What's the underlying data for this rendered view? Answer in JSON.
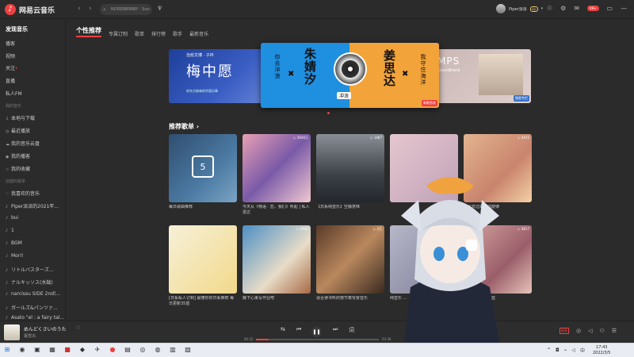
{
  "app": {
    "name": "网易云音乐"
  },
  "header": {
    "back": "‹",
    "forward": "›",
    "search_text": "NOISEBRINNY · Sun",
    "user_name": "Piper派派",
    "vip": "vip",
    "badge": "99+"
  },
  "sidebar": {
    "main": [
      "发现音乐",
      "播客",
      "视频",
      "关注",
      "直播",
      "私人FM"
    ],
    "my_music_head": "我的音乐",
    "my_music": [
      "本地与下载",
      "最近播放",
      "我的音乐云盘",
      "我的播客",
      "我的收藏"
    ],
    "created_head": "创建的歌单",
    "playlists": [
      "我喜欢的音乐",
      "Piper派派的2021年...",
      "bui",
      "1",
      "BGM",
      "Mori!",
      "リトルバスターズ...",
      "ナルキッソス(水鉞)",
      "narcissu SIDE 2nd(...",
      "ガールズ&パンツァ...",
      "Asato \"el : a fairy tal..."
    ]
  },
  "tabs": [
    "个性推荐",
    "专属订制",
    "歌单",
    "排行榜",
    "歌手",
    "最新音乐"
  ],
  "banners": {
    "left": {
      "top": "治愈文博 · 子衿",
      "title": "梅中愿",
      "bottom": "听东方韵味的华丽乐章"
    },
    "center": {
      "left_small": "你去冲浪",
      "left_big": "朱婧汐",
      "right_big": "姜思达",
      "right_small": "我守住海洋",
      "disc_label": "冲浪",
      "tag": "新歌首发"
    },
    "right": {
      "title": "MPS",
      "sub": "Soundtrack",
      "tag": "独家专栏"
    }
  },
  "section_title": "推荐歌单 ›",
  "cards": [
    {
      "title": "每日歌曲推荐",
      "count": "",
      "day": "5"
    },
    {
      "title": "今天从《物语 · 恋，我们》听起 | 私人雷达",
      "count": "▷ 5936万"
    },
    {
      "title": "【日系纯音乐】空静意味",
      "count": "▷ 1487"
    },
    {
      "title": "",
      "count": ""
    },
    {
      "title": "你喜欢过的心动旋律",
      "count": "▷ 4472"
    },
    {
      "title": "[日系私人订制] 最懂你的日系推荐 每日更新35首",
      "count": ""
    },
    {
      "title": "静下心来写作业吧",
      "count": "▷ 5932"
    },
    {
      "title": "适合读书听的慢节奏背景音乐",
      "count": "▷ 2万"
    },
    {
      "title": "纯音乐 ...",
      "count": ""
    },
    {
      "title": "二十世纪光年的蓝",
      "count": "▷ 4817"
    }
  ],
  "player": {
    "song": "めんどくさいのうた",
    "artist": "霜雪出",
    "time_elapsed": "00:22",
    "time_total": "03:36",
    "progress": 0.1,
    "quality": "极高"
  },
  "taskbar": {
    "time": "17:43",
    "date": "2022/3/5"
  },
  "colors": {
    "accent": "#ec4141",
    "background": "#2b2b2b"
  }
}
